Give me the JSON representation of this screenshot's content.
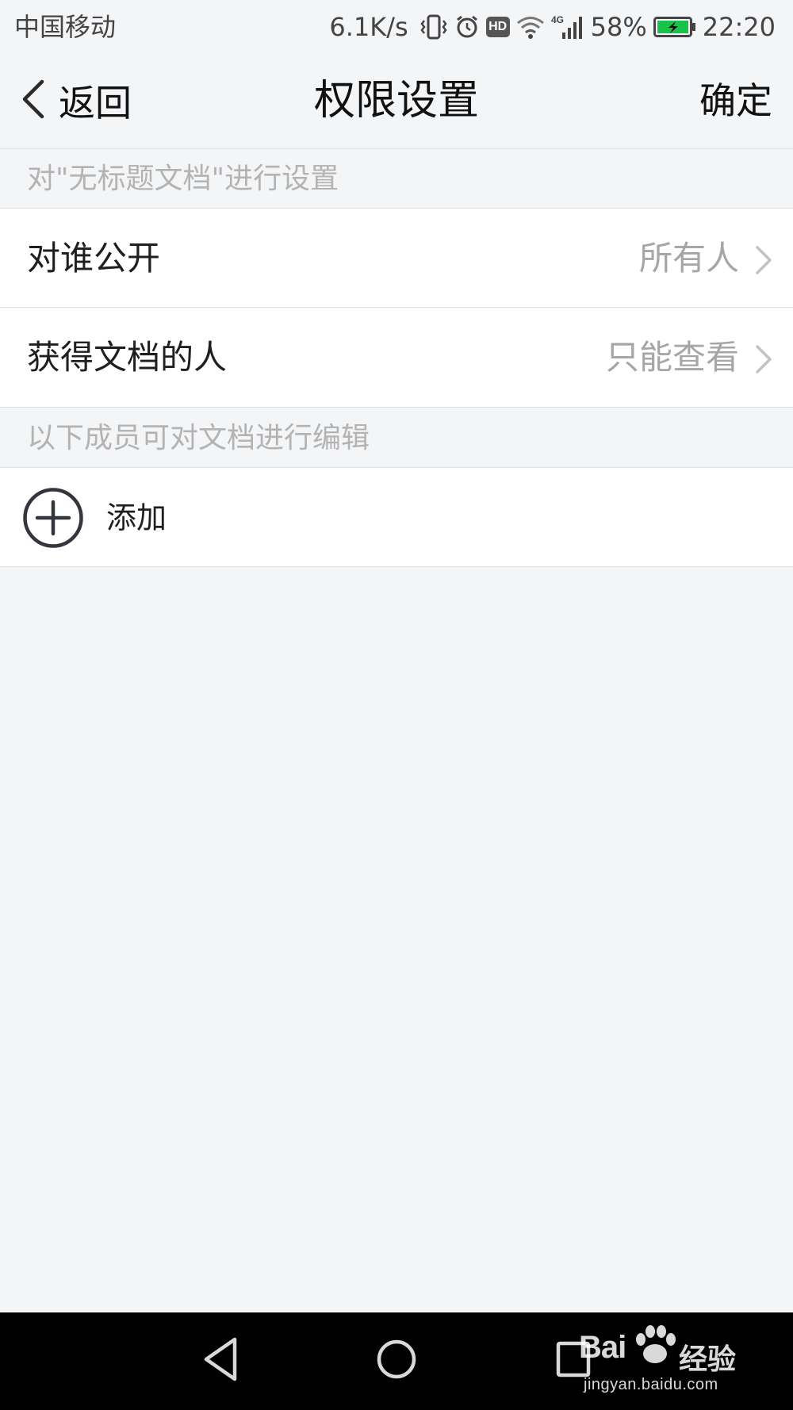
{
  "status_bar": {
    "carrier": "中国移动",
    "network_speed": "6.1K/s",
    "hd_badge": "HD",
    "network_type": "4G",
    "battery": "58%",
    "time": "22:20"
  },
  "nav": {
    "back_label": "返回",
    "title": "权限设置",
    "confirm_label": "确定"
  },
  "section1": {
    "header": "对\"无标题文档\"进行设置",
    "rows": [
      {
        "label": "对谁公开",
        "value": "所有人"
      },
      {
        "label": "获得文档的人",
        "value": "只能查看"
      }
    ]
  },
  "section2": {
    "header": "以下成员可对文档进行编辑",
    "add_label": "添加"
  },
  "watermark": {
    "logo": "Bai",
    "logo_suffix": "经验",
    "url": "jingyan.baidu.com"
  },
  "colors": {
    "background": "#f4f5f7",
    "row_background": "#ffffff",
    "secondary_text": "#a6a6a6",
    "battery_fill": "#19c24b"
  }
}
